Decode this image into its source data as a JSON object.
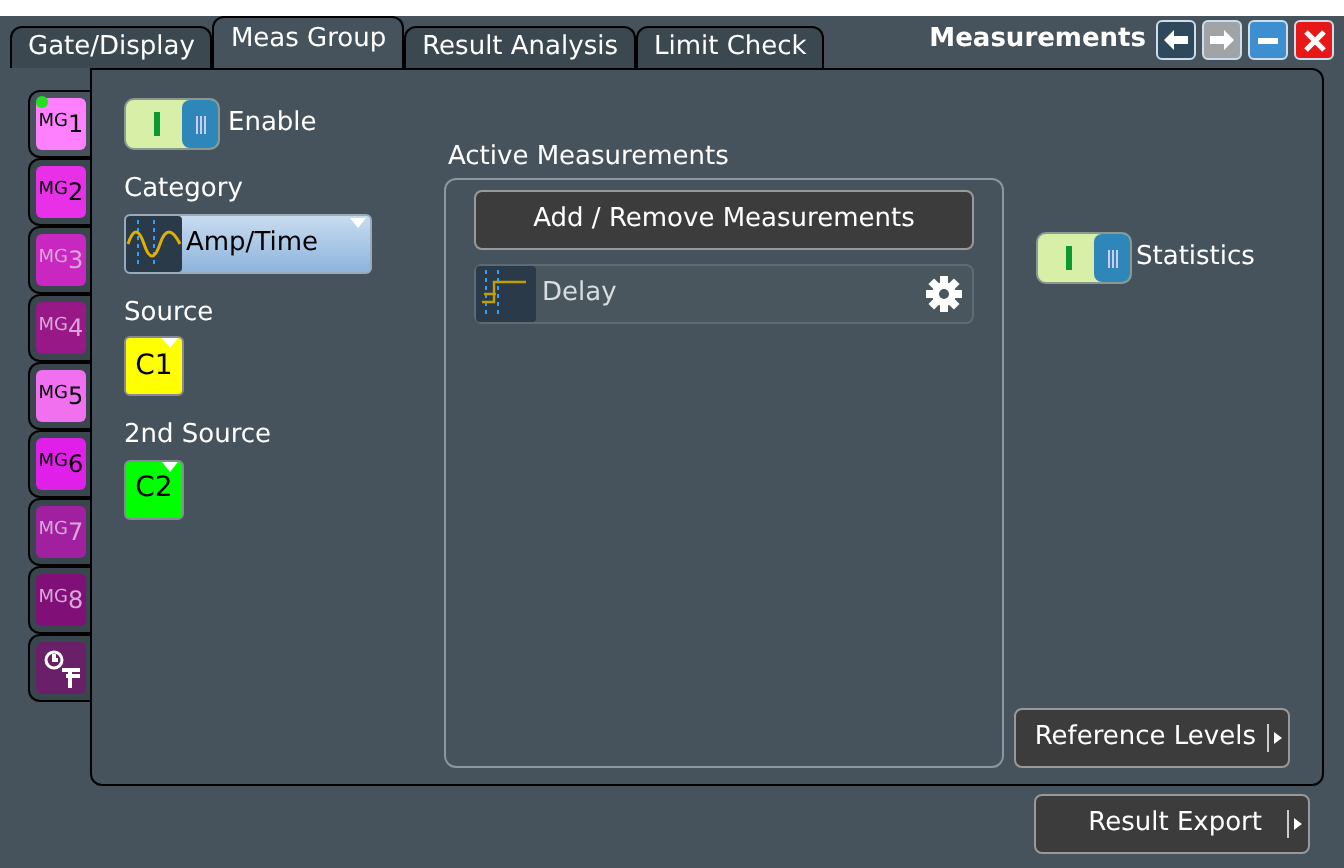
{
  "tabs": [
    {
      "label": "Gate/Display",
      "selected": false
    },
    {
      "label": "Meas Group",
      "selected": true
    },
    {
      "label": "Result Analysis",
      "selected": false
    },
    {
      "label": "Limit Check",
      "selected": false
    }
  ],
  "window": {
    "title": "Measurements",
    "buttons": [
      {
        "kind": "back",
        "disabled": false
      },
      {
        "kind": "forward",
        "disabled": true
      },
      {
        "kind": "minimize",
        "disabled": false
      },
      {
        "kind": "close",
        "disabled": false
      }
    ]
  },
  "group_tabs": [
    {
      "kind": "group",
      "prefix": "MG",
      "number": "1",
      "color": "#ff80ff",
      "selected": true,
      "active": true,
      "disabled": false
    },
    {
      "kind": "group",
      "prefix": "MG",
      "number": "2",
      "color": "#e830e8",
      "selected": false,
      "active": false,
      "disabled": false
    },
    {
      "kind": "group",
      "prefix": "MG",
      "number": "3",
      "color": "#c828c0",
      "selected": false,
      "active": false,
      "disabled": true
    },
    {
      "kind": "group",
      "prefix": "MG",
      "number": "4",
      "color": "#981888",
      "selected": false,
      "active": false,
      "disabled": true
    },
    {
      "kind": "group",
      "prefix": "MG",
      "number": "5",
      "color": "#f070f0",
      "selected": false,
      "active": false,
      "disabled": false
    },
    {
      "kind": "group",
      "prefix": "MG",
      "number": "6",
      "color": "#e020e8",
      "selected": false,
      "active": false,
      "disabled": false
    },
    {
      "kind": "group",
      "prefix": "MG",
      "number": "7",
      "color": "#a020a0",
      "selected": false,
      "active": false,
      "disabled": true
    },
    {
      "kind": "group",
      "prefix": "MG",
      "number": "8",
      "color": "#801078",
      "selected": false,
      "active": false,
      "disabled": true
    },
    {
      "kind": "timer",
      "color": "#6a2068",
      "selected": false,
      "active": false,
      "disabled": false
    }
  ],
  "enable": {
    "label": "Enable",
    "on": true
  },
  "category": {
    "label": "Category",
    "value": "Amp/Time"
  },
  "source": {
    "label": "Source",
    "value": "C1",
    "color": "#ffff00"
  },
  "second_source": {
    "label": "2nd Source",
    "value": "C2",
    "color": "#00ff00"
  },
  "active_measurements": {
    "title": "Active Measurements",
    "add_button": "Add / Remove Measurements",
    "items": [
      {
        "label": "Delay"
      }
    ]
  },
  "statistics": {
    "label": "Statistics",
    "on": true
  },
  "reference_levels": {
    "label": "Reference Levels"
  },
  "result_export": {
    "label": "Result Export"
  }
}
